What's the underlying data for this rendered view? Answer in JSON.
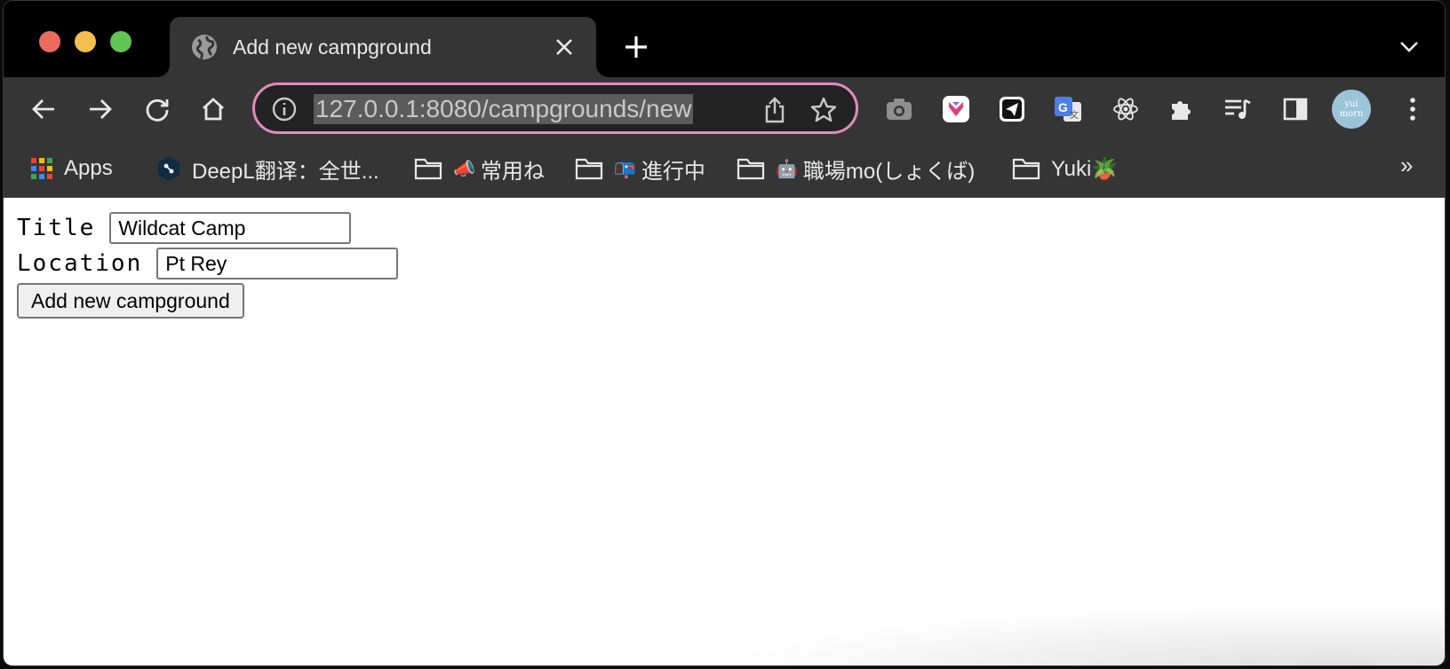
{
  "tab": {
    "title": "Add new campground"
  },
  "address_bar": {
    "url": "127.0.0.1:8080/campgrounds/new"
  },
  "profile": {
    "avatar_line1": "yui",
    "avatar_line2": "morn"
  },
  "bookmarks": [
    {
      "label": "Apps",
      "icon": "apps-grid-icon"
    },
    {
      "label": "DeepL翻译：全世...",
      "icon": "deepl-icon"
    },
    {
      "label": "常用ね",
      "icon": "folder-icon",
      "emoji": "📣"
    },
    {
      "label": "進行中",
      "icon": "folder-icon",
      "emoji": "📭"
    },
    {
      "label": "職場mo(しょくば)",
      "icon": "folder-icon",
      "emoji": "🤖"
    },
    {
      "label": "Yuki🪴",
      "icon": "folder-icon"
    }
  ],
  "bookmarks_more": "»",
  "form": {
    "title_label": "Title",
    "title_value": "Wildcat Camp",
    "location_label": "Location",
    "location_value": "Pt Rey",
    "submit_label": "Add new campground"
  },
  "colors": {
    "omnibox_border": "#e28bbd",
    "toolbar": "#353535",
    "tabstrip": "#000000"
  }
}
